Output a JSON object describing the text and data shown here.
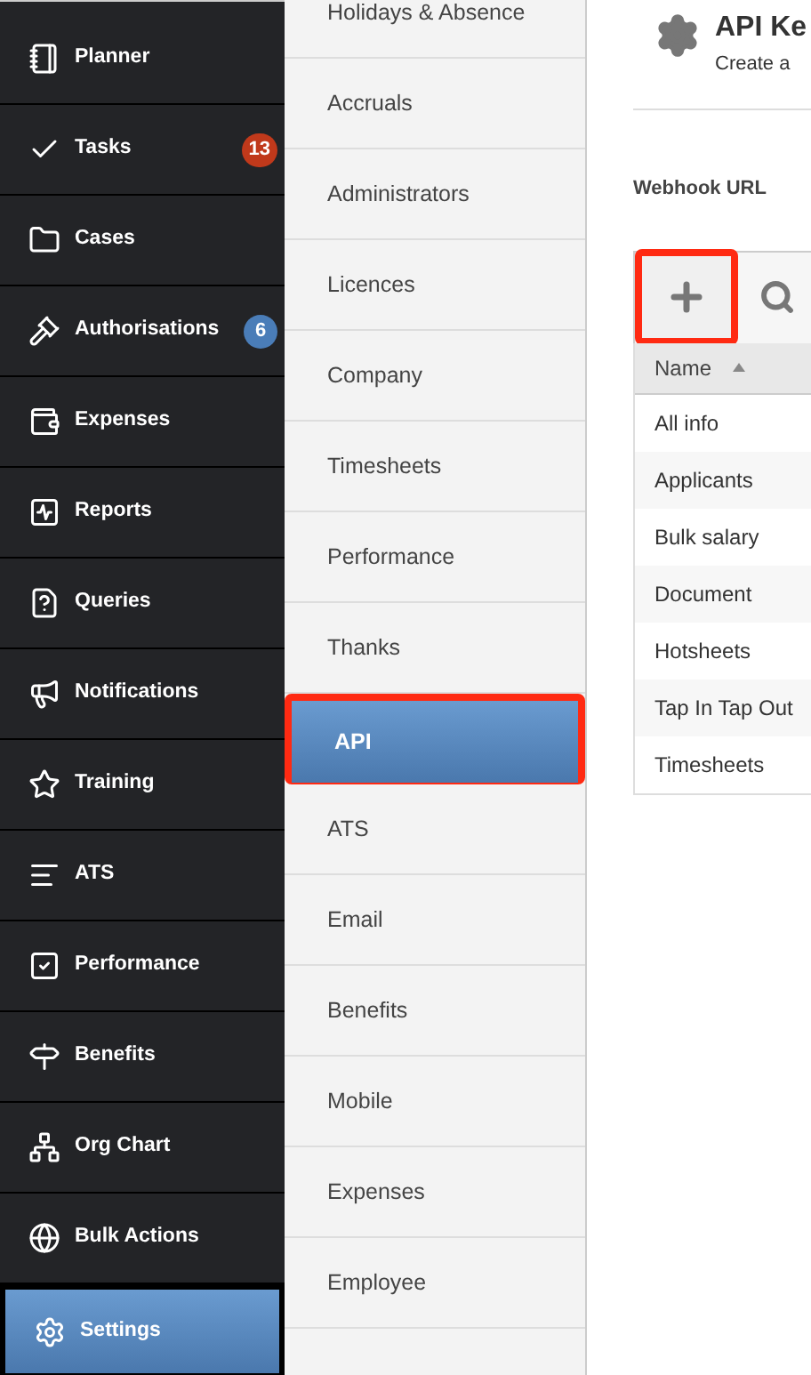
{
  "sidebar": {
    "items": [
      {
        "label": "Planner",
        "selected": false,
        "highlighted": false
      },
      {
        "label": "Tasks",
        "selected": false,
        "highlighted": false,
        "badge": {
          "text": "13",
          "color": "#c0391b"
        }
      },
      {
        "label": "Cases",
        "selected": false,
        "highlighted": false
      },
      {
        "label": "Authorisations",
        "selected": false,
        "highlighted": false,
        "badge": {
          "text": "6",
          "color": "#4a7db8"
        }
      },
      {
        "label": "Expenses",
        "selected": false,
        "highlighted": false
      },
      {
        "label": "Reports",
        "selected": false,
        "highlighted": false
      },
      {
        "label": "Queries",
        "selected": false,
        "highlighted": false
      },
      {
        "label": "Notifications",
        "selected": false,
        "highlighted": false
      },
      {
        "label": "Training",
        "selected": false,
        "highlighted": false
      },
      {
        "label": "ATS",
        "selected": false,
        "highlighted": false
      },
      {
        "label": "Performance",
        "selected": false,
        "highlighted": false
      },
      {
        "label": "Benefits",
        "selected": false,
        "highlighted": false
      },
      {
        "label": "Org Chart",
        "selected": false,
        "highlighted": false
      },
      {
        "label": "Bulk Actions",
        "selected": false,
        "highlighted": false
      },
      {
        "label": "Settings",
        "selected": true,
        "highlighted": true
      }
    ]
  },
  "settings_menu": {
    "items": [
      {
        "label": "Holidays & Absence",
        "selected": false,
        "highlighted": false
      },
      {
        "label": "Accruals",
        "selected": false,
        "highlighted": false
      },
      {
        "label": "Administrators",
        "selected": false,
        "highlighted": false
      },
      {
        "label": "Licences",
        "selected": false,
        "highlighted": false
      },
      {
        "label": "Company",
        "selected": false,
        "highlighted": false
      },
      {
        "label": "Timesheets",
        "selected": false,
        "highlighted": false
      },
      {
        "label": "Performance",
        "selected": false,
        "highlighted": false
      },
      {
        "label": "Thanks",
        "selected": false,
        "highlighted": false
      },
      {
        "label": "API",
        "selected": true,
        "highlighted": true
      },
      {
        "label": "ATS",
        "selected": false,
        "highlighted": false
      },
      {
        "label": "Email",
        "selected": false,
        "highlighted": false
      },
      {
        "label": "Benefits",
        "selected": false,
        "highlighted": false
      },
      {
        "label": "Mobile",
        "selected": false,
        "highlighted": false
      },
      {
        "label": "Expenses",
        "selected": false,
        "highlighted": false
      },
      {
        "label": "Employee",
        "selected": false,
        "highlighted": false
      }
    ]
  },
  "page": {
    "title": "API Ke",
    "subtitle": "Create a",
    "section_label": "Webhook URL"
  },
  "toolbar": {
    "add_button_highlighted": true
  },
  "table": {
    "columns": [
      {
        "label": "Name",
        "sort_ascending": true
      }
    ],
    "rows": [
      "All info",
      "Applicants",
      "Bulk salary",
      "Document",
      "Hotsheets",
      "Tap In Tap Out",
      "Timesheets"
    ]
  }
}
